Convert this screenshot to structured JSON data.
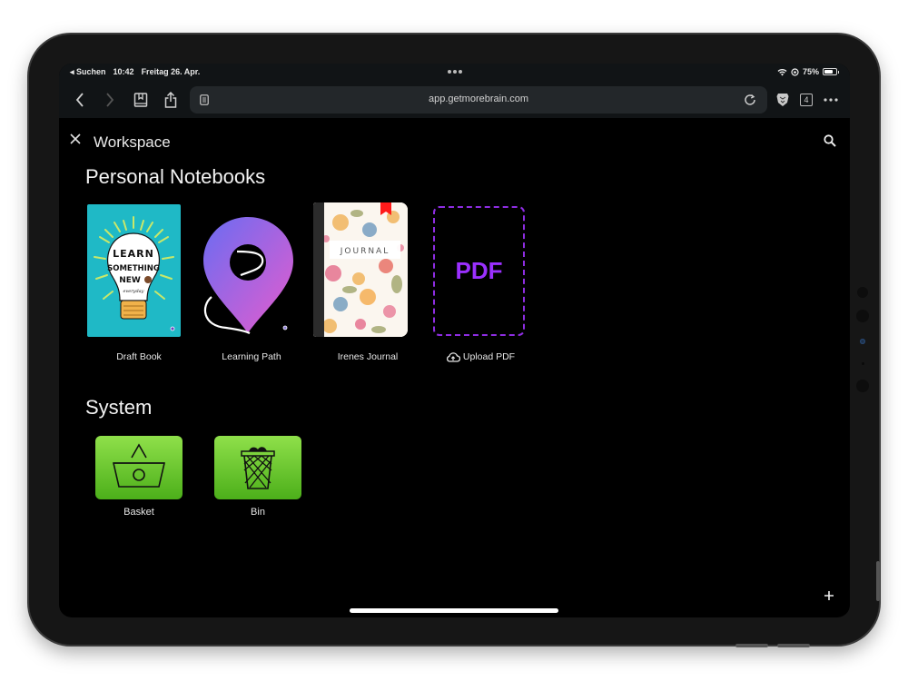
{
  "status_bar": {
    "back_app": "◂ Suchen",
    "time": "10:42",
    "date": "Freitag 26. Apr.",
    "battery_percent": "75%",
    "battery_level": 0.75
  },
  "browser": {
    "url": "app.getmorebrain.com",
    "tab_count": "4"
  },
  "header": {
    "title": "Workspace"
  },
  "sections": {
    "notebooks_title": "Personal Notebooks",
    "system_title": "System"
  },
  "notebooks": [
    {
      "label": "Draft Book",
      "cover_text": [
        "LEARN",
        "SOMETHING",
        "NEW",
        "everyday"
      ]
    },
    {
      "label": "Learning Path"
    },
    {
      "label": "Irenes Journal",
      "cover_text": "JOURNAL"
    },
    {
      "label": "Upload PDF",
      "cover_text": "PDF"
    }
  ],
  "system": [
    {
      "label": "Basket"
    },
    {
      "label": "Bin"
    }
  ],
  "colors": {
    "accent_purple": "#9b30ff",
    "system_green_top": "#8fe04a",
    "system_green_bottom": "#4caf1a",
    "draft_cover": "#1fb9c6"
  }
}
